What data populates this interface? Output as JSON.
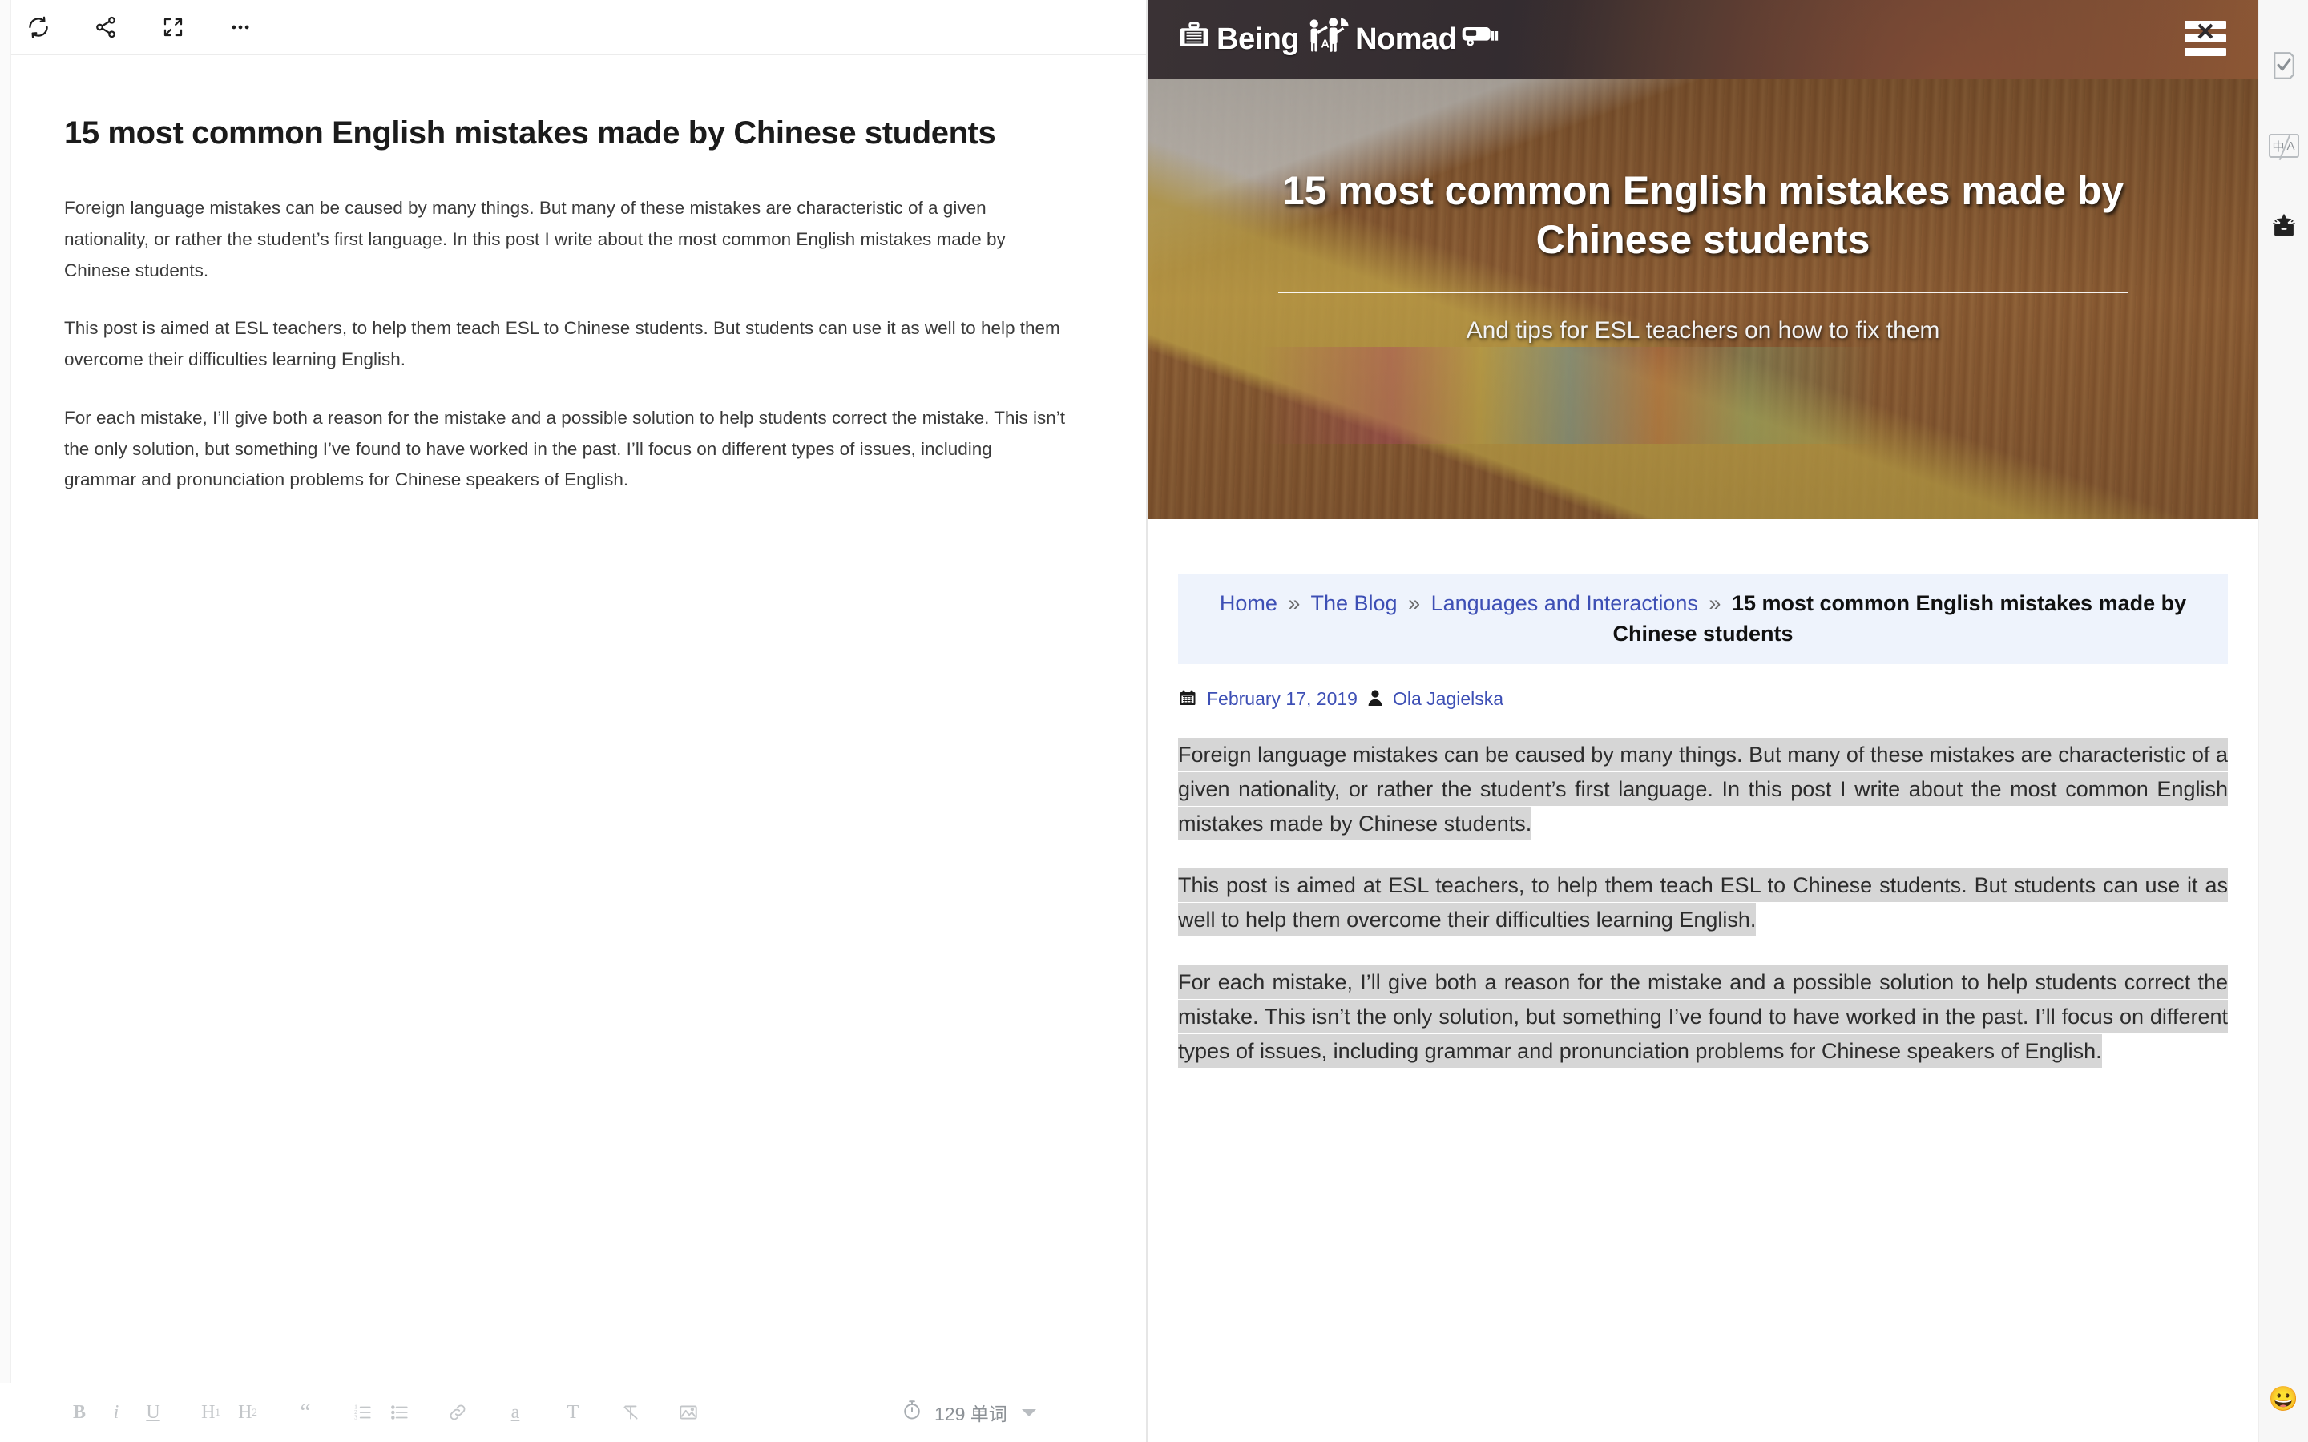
{
  "editor": {
    "toolbar": {
      "items": [
        {
          "name": "sync-icon",
          "label": "Sync"
        },
        {
          "name": "share-icon",
          "label": "Share"
        },
        {
          "name": "fullscreen-icon",
          "label": "Fullscreen"
        },
        {
          "name": "more-options-icon",
          "label": "More"
        }
      ]
    },
    "document": {
      "title": "15 most common English mistakes made by Chinese students",
      "paragraphs": [
        "Foreign language mistakes can be caused by many things. But many of these mistakes are characteristic of a given nationality, or rather the student’s first language. In this post I write about the most common English mistakes made by Chinese students.",
        "This post is aimed at ESL teachers, to help them teach ESL to Chinese students. But students can use it as well to help them overcome their difficulties learning English.",
        "For each mistake, I’ll give both a reason for the mistake and a possible solution to help students correct the mistake. This isn’t the only solution, but something I’ve found to have worked in the past. I’ll focus on different types of issues, including grammar and pronunciation problems for Chinese speakers of English."
      ]
    },
    "format_toolbar": {
      "bold": "B",
      "italic": "i",
      "underline": "U",
      "heading1": "H",
      "heading1_sub": "1",
      "heading2": "H",
      "heading2_sub": "2",
      "quote": "“",
      "ordered_list": "ordered-list-icon",
      "unordered_list": "unordered-list-icon",
      "link": "link-icon",
      "highlight": "a",
      "text_style": "T",
      "clear_format": "clear-format-icon",
      "insert_image": "image-icon"
    },
    "status": {
      "timer_icon": "stopwatch-icon",
      "word_count": "129 单词"
    }
  },
  "preview": {
    "site": {
      "logo_text_1": "Being",
      "logo_text_2": "A",
      "logo_text_3": "Nomad",
      "menu_icon": "hamburger-menu-icon"
    },
    "hero": {
      "title": "15 most common English mistakes made by Chinese students",
      "subtitle": "And tips for ESL teachers on how to fix them"
    },
    "breadcrumb": {
      "items": [
        {
          "label": "Home",
          "link": true
        },
        {
          "label": "The Blog",
          "link": true
        },
        {
          "label": "Languages and Interactions",
          "link": true
        },
        {
          "label": "15 most common English mistakes made by Chinese students",
          "link": false
        }
      ],
      "separator": "»"
    },
    "meta": {
      "date_icon": "calendar-icon",
      "date": "February 17, 2019",
      "author_icon": "user-icon",
      "author": "Ola Jagielska"
    },
    "paragraphs": [
      "Foreign language mistakes can be caused by many things. But many of these mistakes are characteristic of a given nationality, or rather the student’s first language. In this post I write about the most common English mistakes made by Chinese students.",
      "This post is aimed at ESL teachers, to help them teach ESL to Chinese students. But students can use it as well to help them overcome their difficulties learning English.",
      "For each mistake, I’ll give both a reason for the mistake and a possible solution to help students correct the mistake. This isn’t the only solution, but something I’ve found to have worked in the past. I’ll focus on different types of issues, including grammar and pronunciation problems for Chinese speakers of English."
    ]
  },
  "right_rail": {
    "items": [
      {
        "name": "proofread-check-icon",
        "label": "Proofread"
      },
      {
        "name": "translate-icon",
        "label": "中/A"
      },
      {
        "name": "gift-box-icon",
        "label": "Surprise"
      }
    ],
    "feedback_emoji": "😀"
  },
  "colors": {
    "breadcrumb_bg": "#eef3fc",
    "link": "#3d4fb5",
    "selection_highlight": "#d6d6d6",
    "header_bg": "#2e2a2c",
    "rail_bg": "#f7f7f7"
  }
}
